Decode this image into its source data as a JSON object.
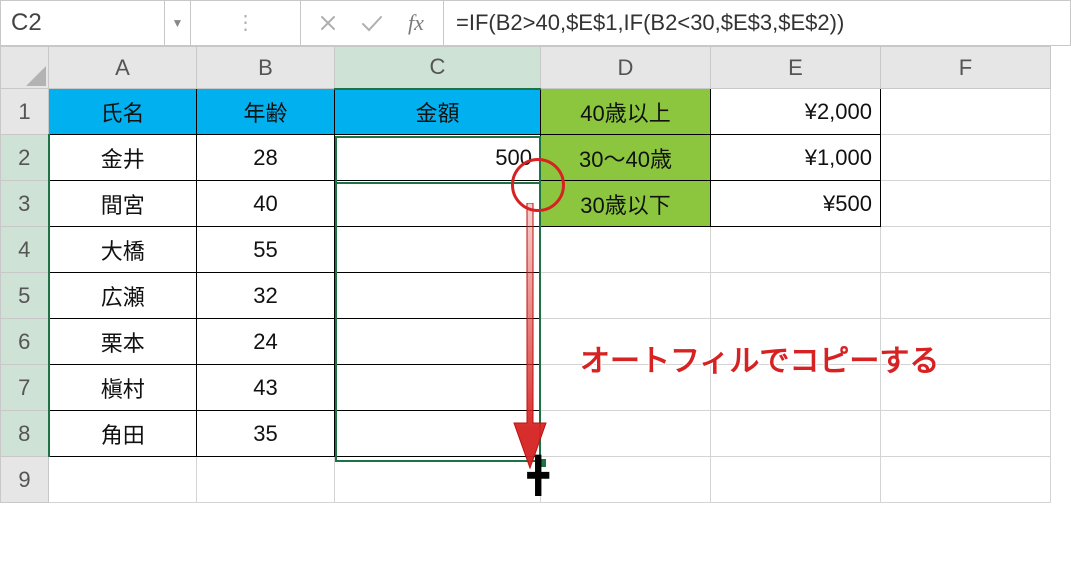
{
  "formula_bar": {
    "name_box": "C2",
    "formula": "=IF(B2>40,$E$1,IF(B2<30,$E$3,$E$2))"
  },
  "columns": [
    "A",
    "B",
    "C",
    "D",
    "E",
    "F"
  ],
  "rows": [
    "1",
    "2",
    "3",
    "4",
    "5",
    "6",
    "7",
    "8",
    "9"
  ],
  "headers_main": {
    "A": "氏名",
    "B": "年齢",
    "C": "金額"
  },
  "lookup": {
    "d1": "40歳以上",
    "d2": "30〜40歳",
    "d3": "30歳以下",
    "e1": "¥2,000",
    "e2": "¥1,000",
    "e3": "¥500"
  },
  "people": [
    {
      "name": "金井",
      "age": "28",
      "amount": "500"
    },
    {
      "name": "間宮",
      "age": "40",
      "amount": ""
    },
    {
      "name": "大橋",
      "age": "55",
      "amount": ""
    },
    {
      "name": "広瀬",
      "age": "32",
      "amount": ""
    },
    {
      "name": "栗本",
      "age": "24",
      "amount": ""
    },
    {
      "name": "槇村",
      "age": "43",
      "amount": ""
    },
    {
      "name": "角田",
      "age": "35",
      "amount": ""
    }
  ],
  "annotation": "オートフィルでコピーする",
  "selected_cell": "C2",
  "selection_range": "C2:C8"
}
